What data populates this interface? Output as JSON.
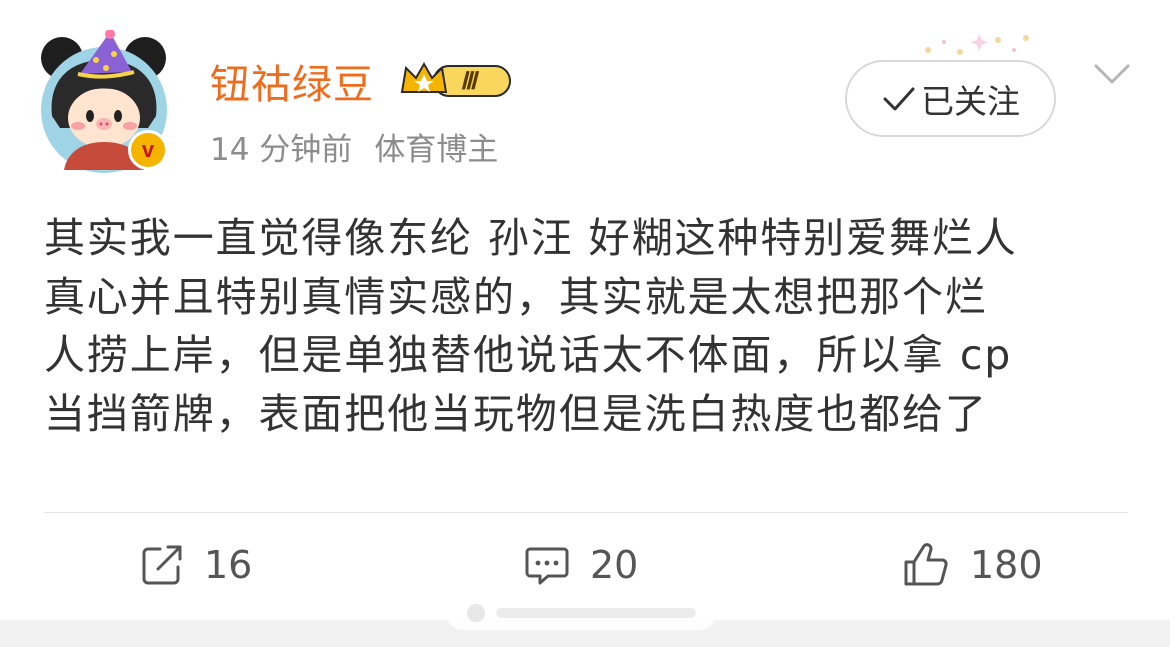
{
  "author": {
    "name": "钮祜绿豆",
    "level_badge_text": "Ⅲ",
    "verified_badge_text": "v",
    "time": "14 分钟前",
    "role": "体育博主"
  },
  "follow_button": {
    "label": "已关注"
  },
  "post": {
    "lines": [
      "其实我一直觉得像东纶 孙汪 好糊这种特别爱舞烂人",
      "真心并且特别真情实感的，其实就是太想把那个烂",
      "人捞上岸，但是单独替他说话太不体面，所以拿 cp",
      "当挡箭牌，表面把他当玩物但是洗白热度也都给了"
    ]
  },
  "actions": {
    "repost_count": "16",
    "comment_count": "20",
    "like_count": "180"
  },
  "colors": {
    "name": "#ee6c1e",
    "meta": "#8c8c8c",
    "text": "#333333",
    "verified": "#f4b400"
  },
  "icons": [
    "repost-icon",
    "comment-icon",
    "like-icon",
    "check-icon",
    "chevron-down-icon",
    "crown-icon"
  ]
}
